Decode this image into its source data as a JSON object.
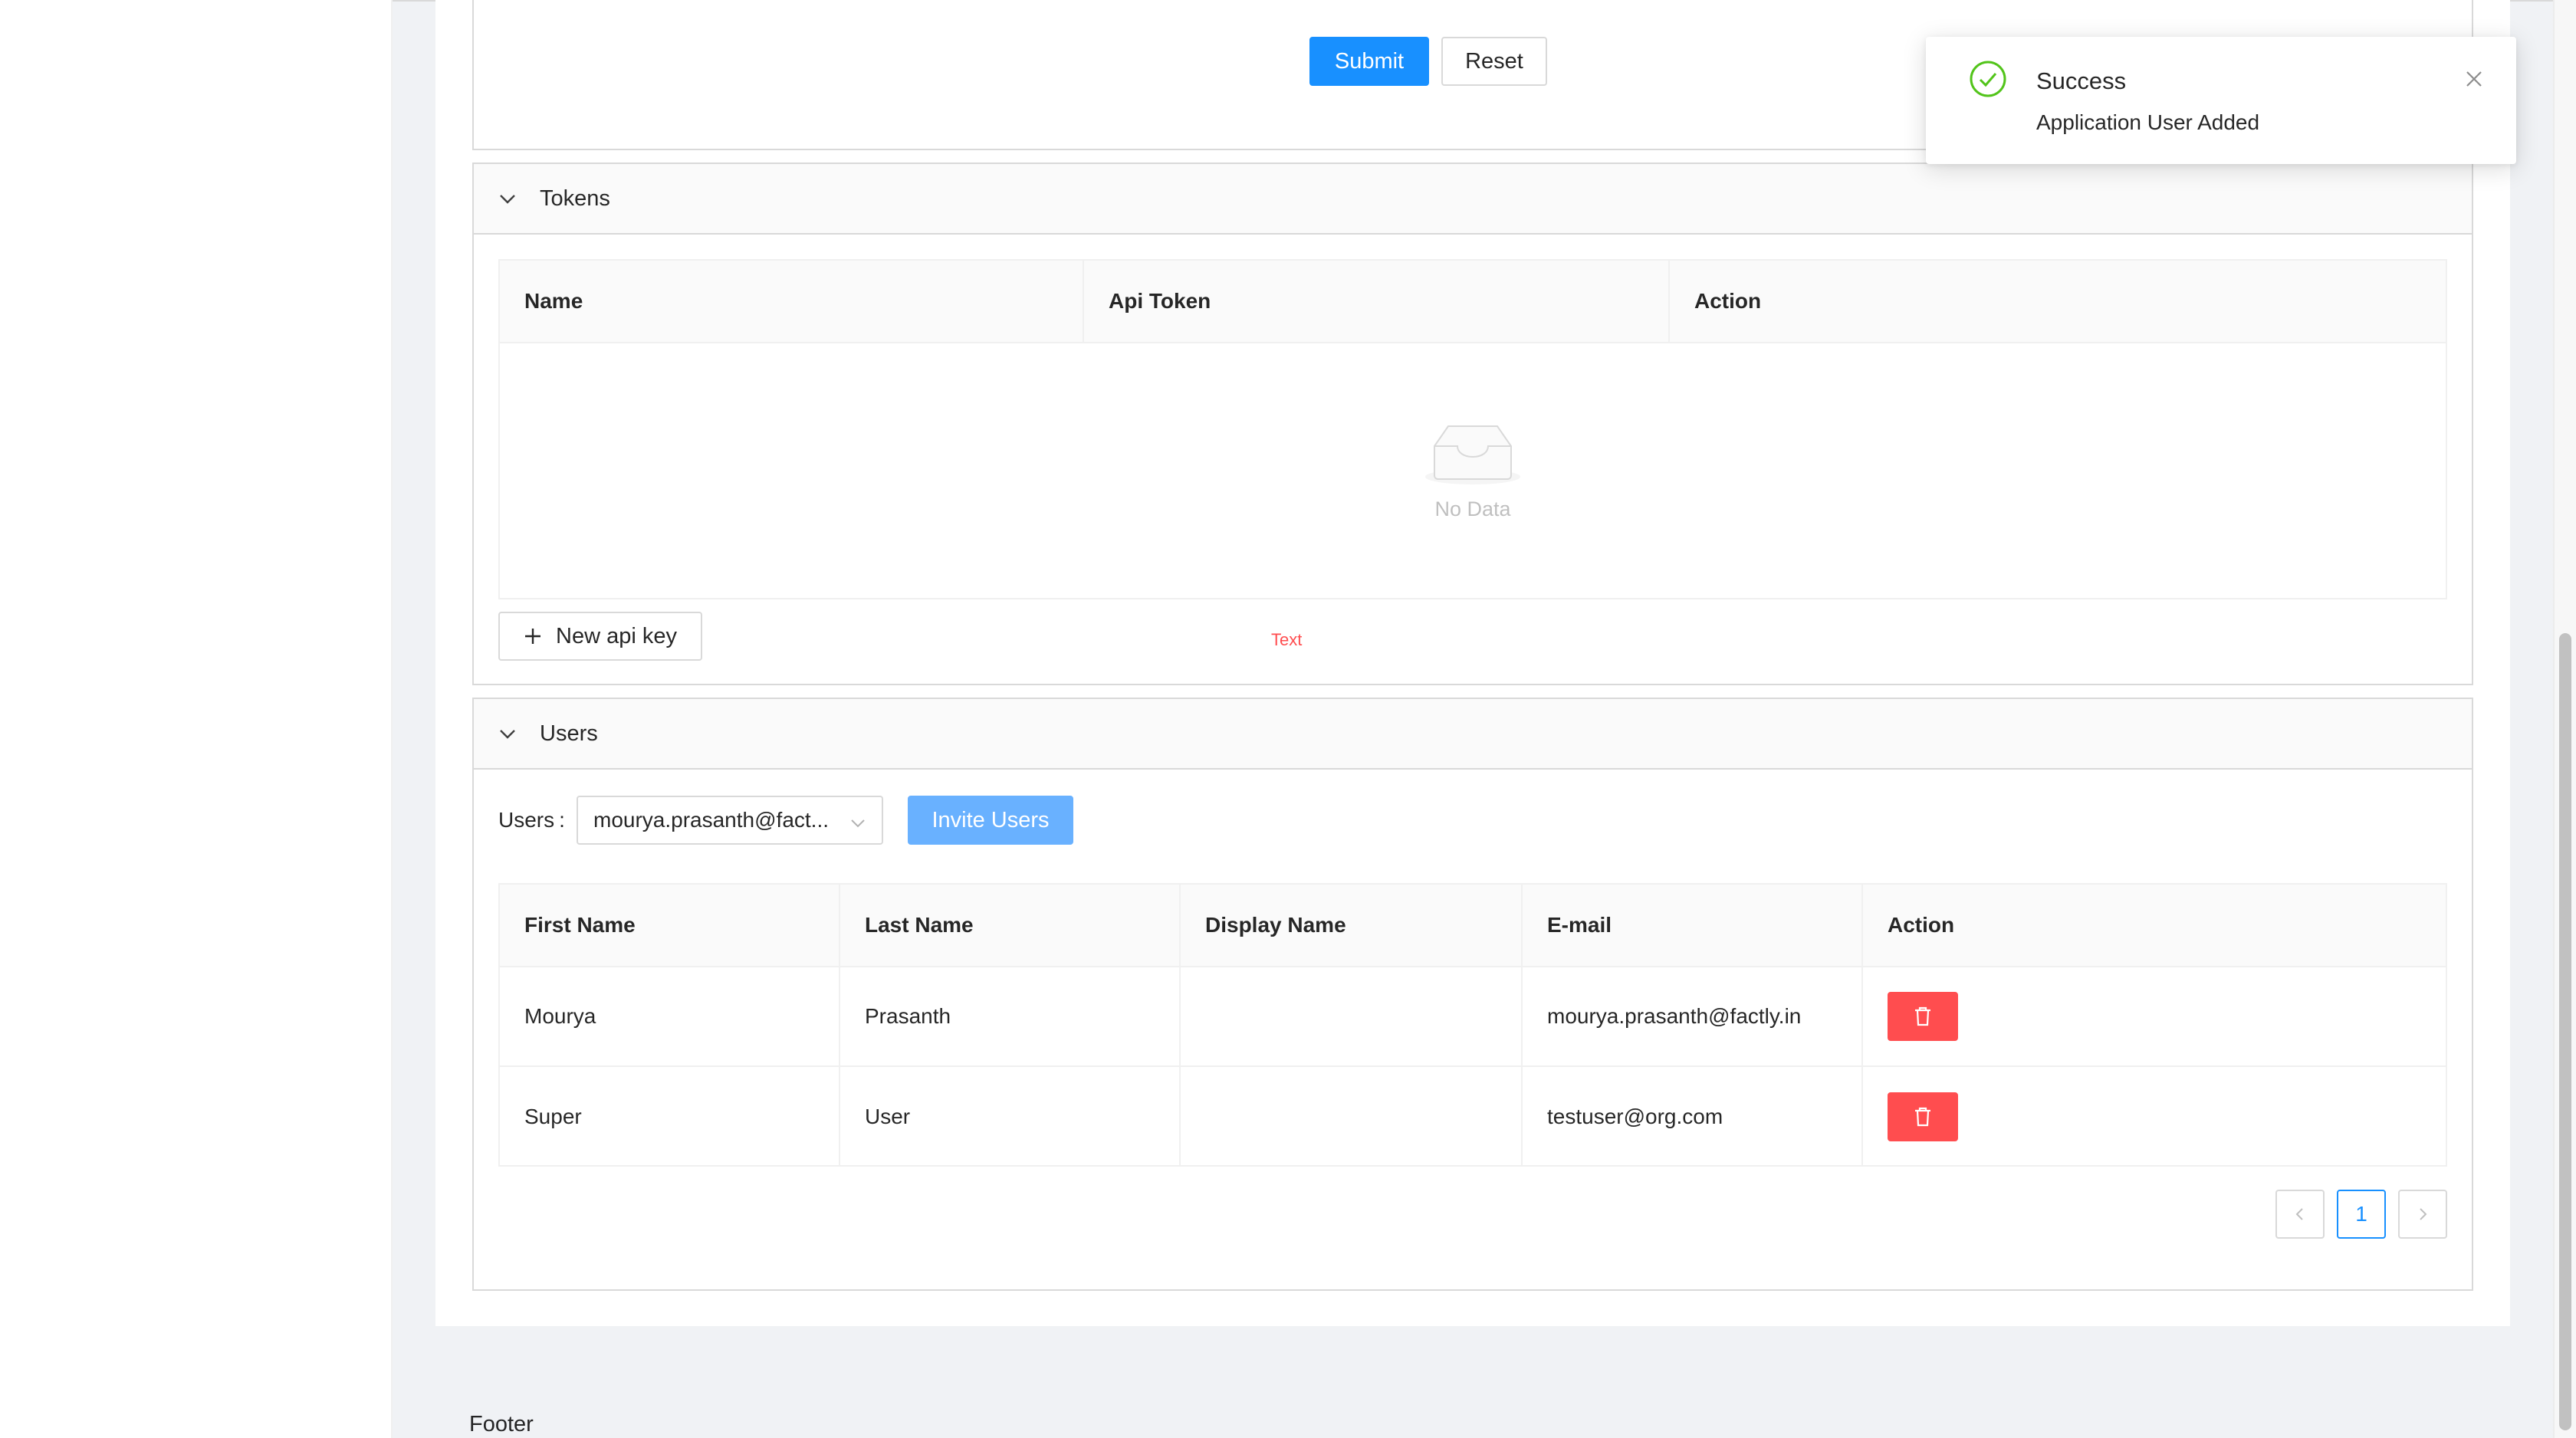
{
  "form": {
    "submit_label": "Submit",
    "reset_label": "Reset"
  },
  "notification": {
    "title": "Success",
    "message": "Application User Added"
  },
  "tokens": {
    "title": "Tokens",
    "columns": [
      "Name",
      "Api Token",
      "Action"
    ],
    "empty_text": "No Data",
    "new_key_label": "New api key",
    "hint_text": "Text"
  },
  "users": {
    "title": "Users",
    "select_label": "Users",
    "select_value": "mourya.prasanth@fact...",
    "invite_label": "Invite Users",
    "columns": [
      "First Name",
      "Last Name",
      "Display Name",
      "E-mail",
      "Action"
    ],
    "rows": [
      {
        "first_name": "Mourya",
        "last_name": "Prasanth",
        "display_name": "",
        "email": "mourya.prasanth@factly.in"
      },
      {
        "first_name": "Super",
        "last_name": "User",
        "display_name": "",
        "email": "testuser@org.com"
      }
    ],
    "current_page": "1"
  },
  "footer": {
    "text": "Footer"
  },
  "colors": {
    "primary": "#1890ff",
    "danger": "#ff4d4f",
    "success": "#52c41a",
    "hint": "#ff4d4f"
  }
}
